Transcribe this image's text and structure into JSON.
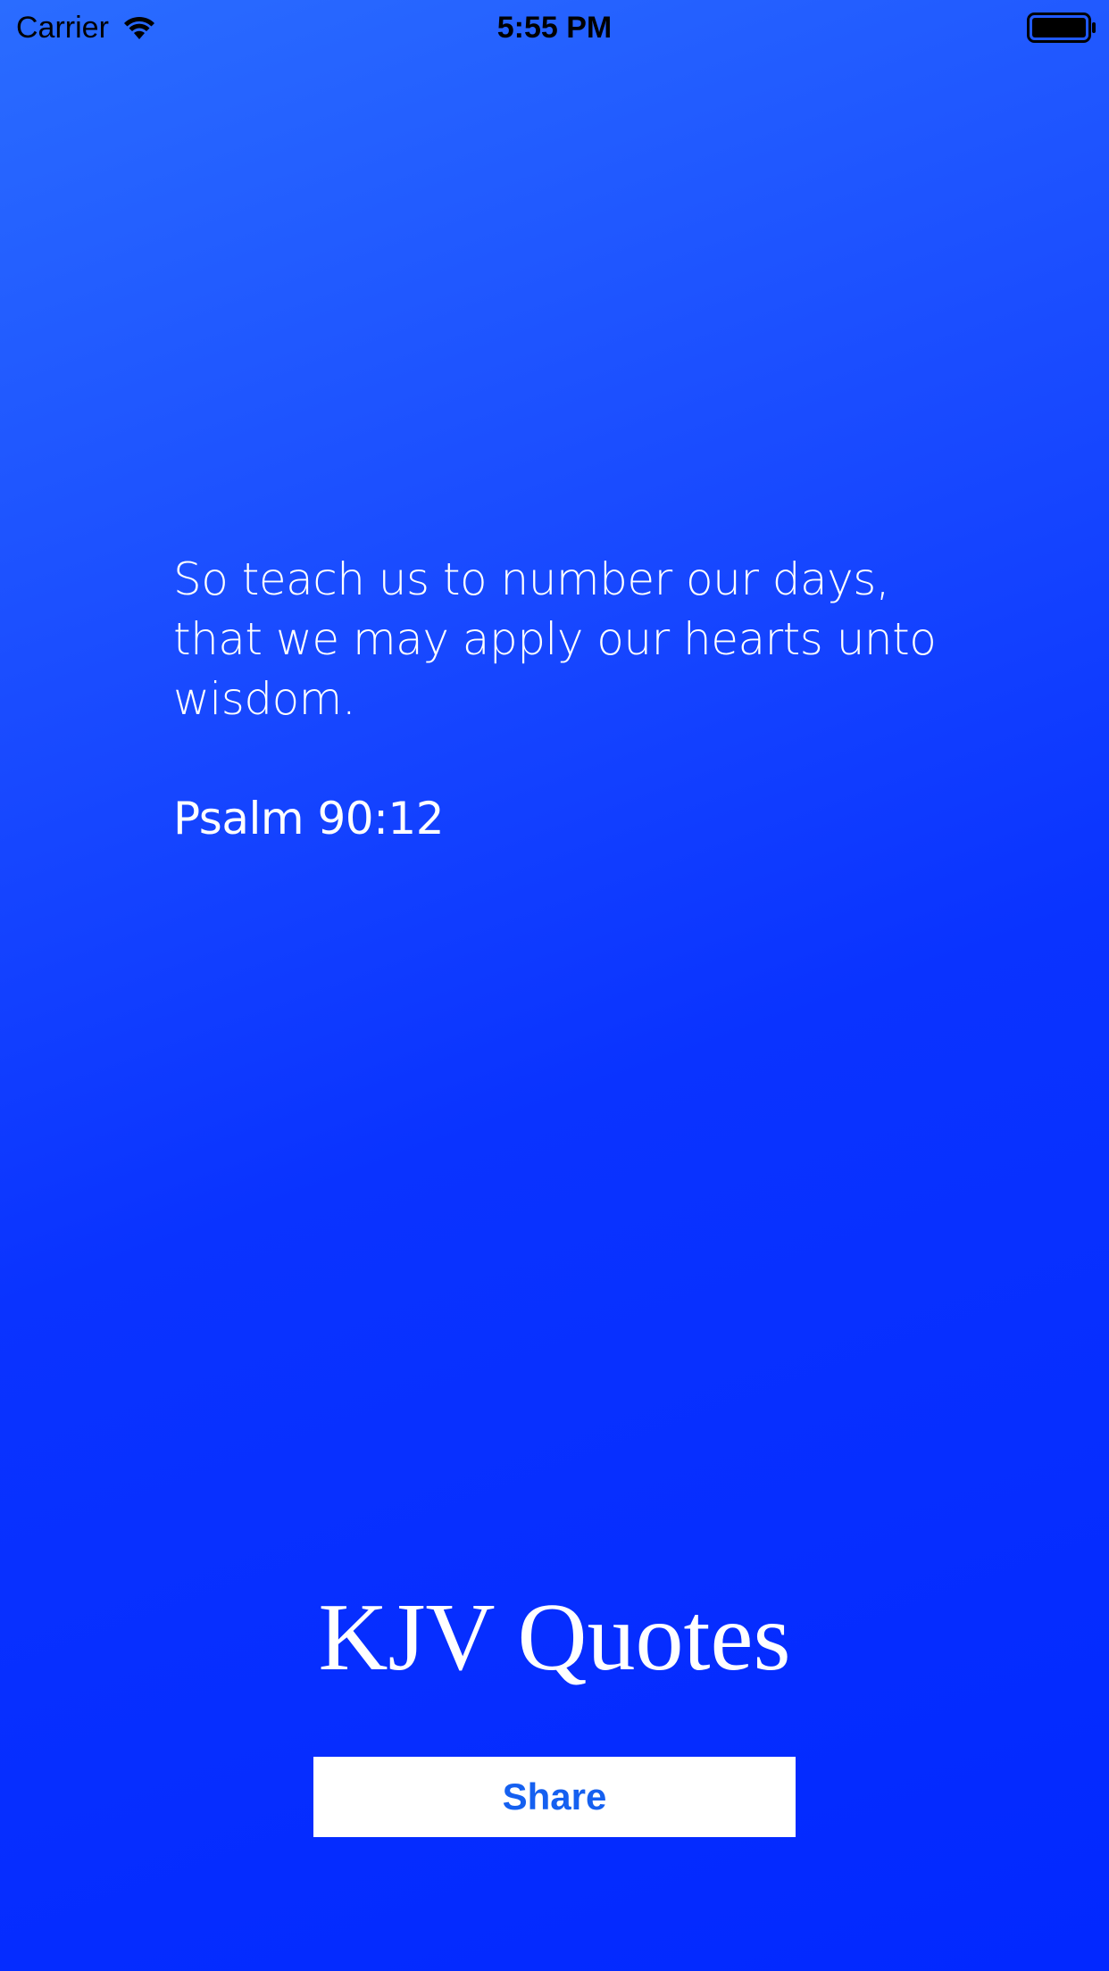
{
  "status_bar": {
    "carrier": "Carrier",
    "time": "5:55 PM",
    "wifi_icon": "wifi-icon",
    "battery_icon": "battery-icon"
  },
  "quote": {
    "text": "So teach us to number our days, that we may apply our hearts unto wisdom.",
    "reference": "Psalm 90:12"
  },
  "app": {
    "title": "KJV Quotes"
  },
  "actions": {
    "share_label": "Share"
  },
  "colors": {
    "background_top": "#2a6cff",
    "background_bottom": "#0228ff",
    "text": "#ffffff",
    "button_background": "#ffffff",
    "button_text": "#1560f0"
  }
}
